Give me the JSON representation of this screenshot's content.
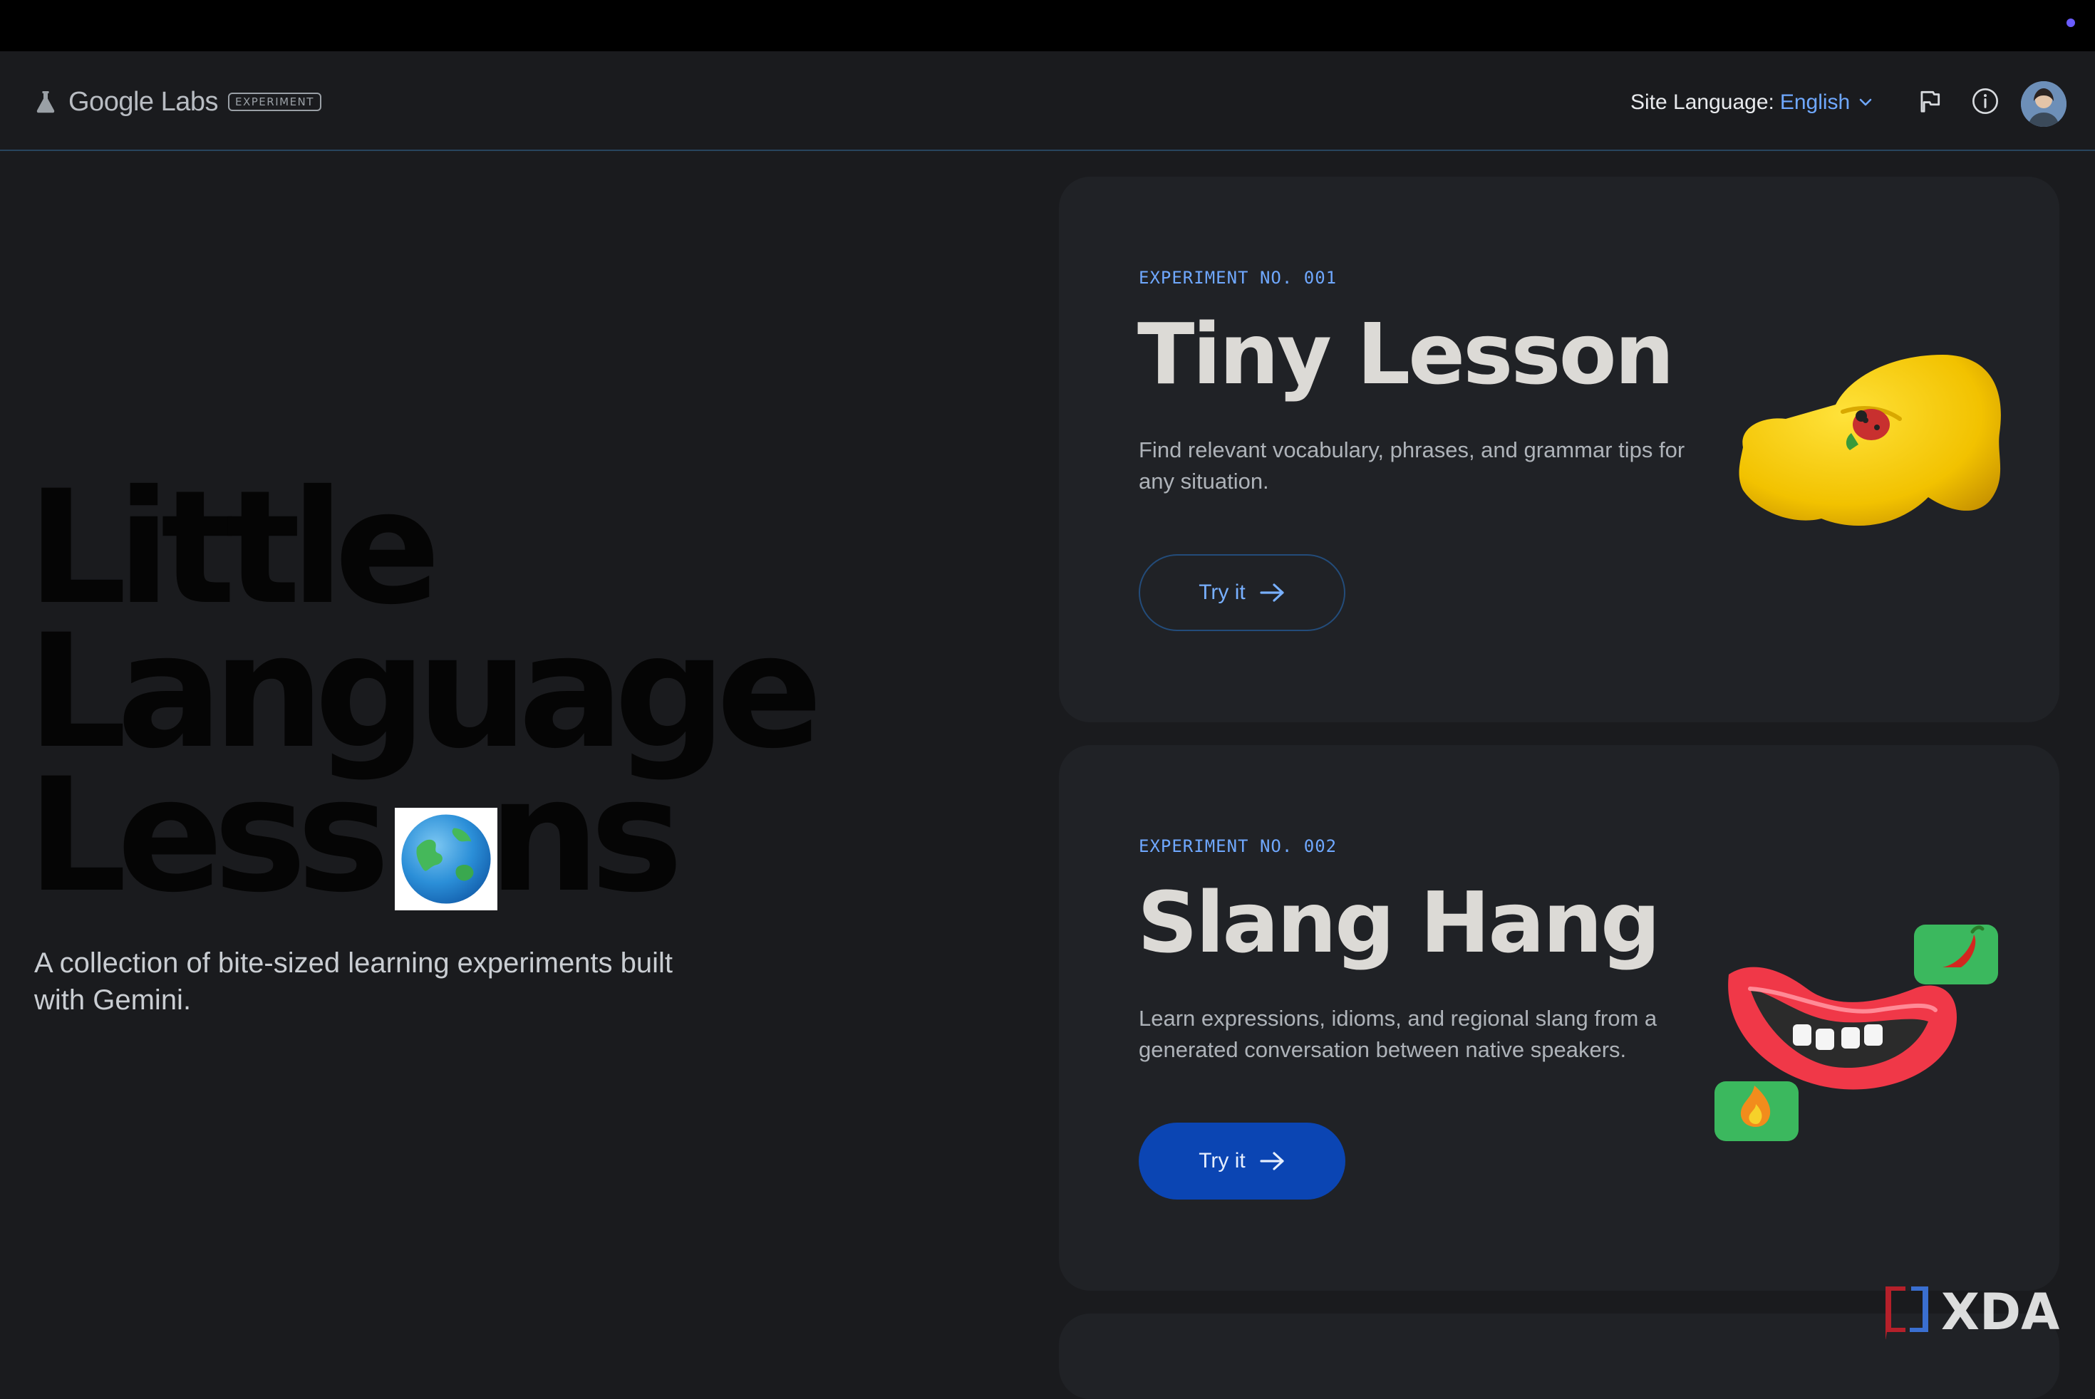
{
  "header": {
    "logo_text": "Google Labs",
    "badge_text": "EXPERIMENT",
    "site_language_label": "Site Language:",
    "site_language_value": "English",
    "icons": [
      "flask-icon",
      "chevron-down-icon",
      "flag-icon",
      "info-icon",
      "avatar"
    ]
  },
  "hero": {
    "title_line1": "Little",
    "title_line2": "Language",
    "title_line3_a": "Less",
    "title_line3_b": "ns",
    "subtitle": "A collection of bite-sized learning experiments built with Gemini."
  },
  "cards": [
    {
      "experiment_no": "EXPERIMENT NO. 001",
      "title": "Tiny Lesson",
      "description": "Find relevant vocabulary, phrases, and grammar tips for any situation.",
      "button_label": "Try it"
    },
    {
      "experiment_no": "EXPERIMENT NO. 002",
      "title": "Slang Hang",
      "description": "Learn expressions, idioms, and regional slang from a generated conversation between native speakers.",
      "button_label": "Try it"
    }
  ],
  "watermark": "XDA",
  "colors": {
    "background": "#1a1b1e",
    "card": "#202226",
    "accent": "#6fa8ff",
    "button_filled": "#0b45b3"
  }
}
